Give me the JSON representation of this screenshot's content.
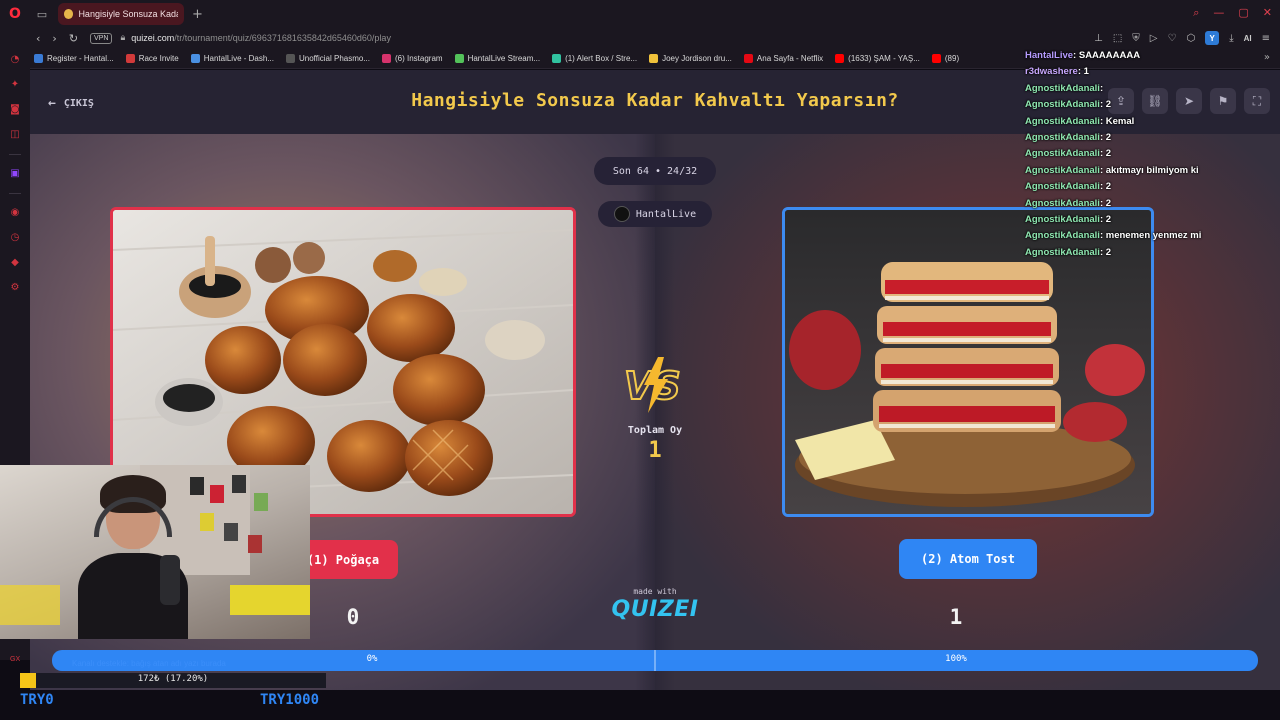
{
  "browser": {
    "tab_title": "Hangisiyle Sonsuza Kadar",
    "new_tab": "+",
    "vpn_label": "VPN",
    "url_domain": "quizei.com",
    "url_path": "/tr/tournament/quiz/696371681635842d65460d60/play",
    "ai_label": "AI",
    "avatar_letter": "Y",
    "bookmarks": [
      {
        "label": "Register - Hantal...",
        "color": "#3a7bd5"
      },
      {
        "label": "Race Invite",
        "color": "#d23a3a"
      },
      {
        "label": "HantalLive - Dash...",
        "color": "#4a90e2"
      },
      {
        "label": "Unofficial Phasmo...",
        "color": "#555555"
      },
      {
        "label": "(6) Instagram",
        "color": "#d6336c"
      },
      {
        "label": "HantalLive Stream...",
        "color": "#53c25a"
      },
      {
        "label": "(1) Alert Box / Stre...",
        "color": "#31c3a0"
      },
      {
        "label": "Joey Jordison dru...",
        "color": "#f0c23b"
      },
      {
        "label": "Ana Sayfa - Netflix",
        "color": "#e50914"
      },
      {
        "label": "(1633) ŞAM - YAŞ...",
        "color": "#ff0000"
      },
      {
        "label": "(89)",
        "color": "#ff0000"
      }
    ]
  },
  "page": {
    "back_label": "ÇIKIŞ",
    "title": "Hangisiyle Sonsuza Kadar Kahvaltı Yaparsın?",
    "round": "Son 64 • 24/32",
    "creator": "HantalLive",
    "total_label": "Toplam Oy",
    "total_value": "1",
    "left_option": "(1) Poğaça",
    "right_option": "(2) Atom Tost",
    "left_votes": "0",
    "right_votes": "1",
    "made_with": "made with",
    "brand": "QUIZEI",
    "left_percent_label": "0%",
    "right_percent_label": "100%",
    "left_share": 0
  },
  "overlay": {
    "ticker_text": "172₺ (17.20%)",
    "ticker_fraction": 0.172,
    "ghost_text": "Kanalı destekle: bağış atan adı yazı burada",
    "gx": "GX",
    "goal_left": "TRY0",
    "goal_right": "TRY1000"
  },
  "chat": [
    {
      "user": "HantalLive",
      "text": "SAAAAAAAA",
      "kind": "ht"
    },
    {
      "user": "r3dwashere",
      "text": "1",
      "kind": "r3"
    },
    {
      "user": "AgnostikAdanali",
      "text": "",
      "kind": "ag"
    },
    {
      "user": "AgnostikAdanali",
      "text": "2",
      "kind": "ag"
    },
    {
      "user": "AgnostikAdanali",
      "text": "Kemal",
      "kind": "ag"
    },
    {
      "user": "AgnostikAdanali",
      "text": "2",
      "kind": "ag"
    },
    {
      "user": "AgnostikAdanali",
      "text": "2",
      "kind": "ag"
    },
    {
      "user": "AgnostikAdanali",
      "text": "akıtmayı bilmiyom ki",
      "kind": "ag"
    },
    {
      "user": "AgnostikAdanali",
      "text": "2",
      "kind": "ag"
    },
    {
      "user": "AgnostikAdanali",
      "text": "2",
      "kind": "ag"
    },
    {
      "user": "AgnostikAdanali",
      "text": "2",
      "kind": "ag"
    },
    {
      "user": "AgnostikAdanali",
      "text": "menemen yenmez mi",
      "kind": "ag"
    },
    {
      "user": "AgnostikAdanali",
      "text": "2",
      "kind": "ag"
    }
  ],
  "colors": {
    "accent_yellow": "#f2c94c",
    "left_red": "#e2304a",
    "right_blue": "#2f86f4",
    "brand_cyan": "#33c3f0"
  }
}
